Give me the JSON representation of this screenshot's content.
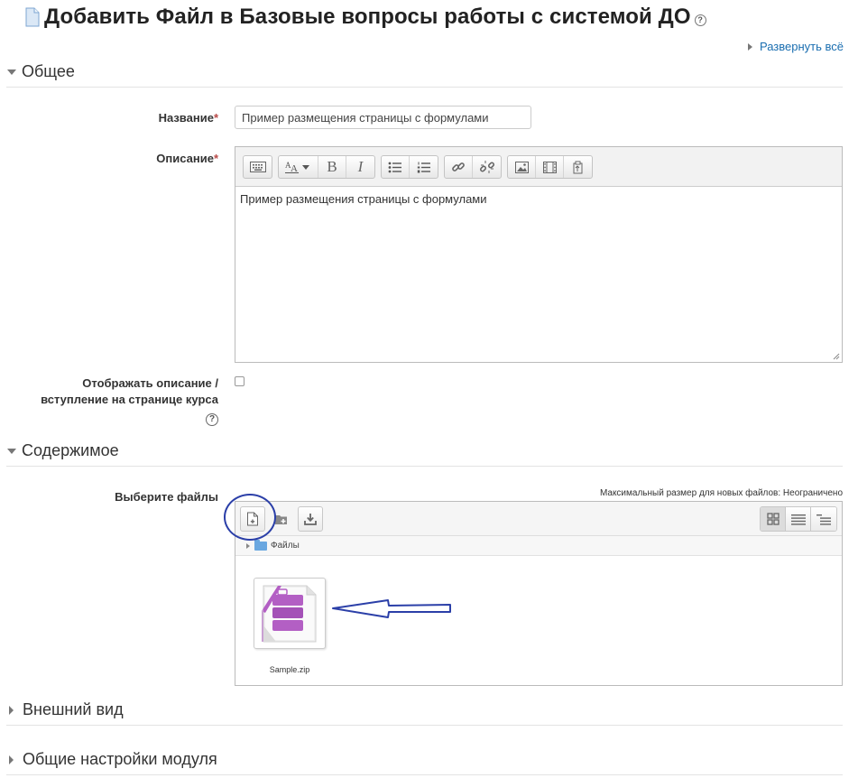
{
  "page": {
    "title": "Добавить Файл в Базовые вопросы работы с системой ДО",
    "title_help": "?",
    "expand_all": "Развернуть всё"
  },
  "sections": {
    "general": "Общее",
    "content": "Содержимое",
    "appearance": "Внешний вид",
    "module_settings": "Общие настройки модуля"
  },
  "form": {
    "name_label": "Название",
    "name_value": "Пример размещения страницы с формулами",
    "required_mark": "*",
    "description_label": "Описание",
    "description_text": "Пример размещения страницы с формулами",
    "show_description_label_1": "Отображать описание /",
    "show_description_label_2": "вступление на странице курса",
    "show_description_checked": false,
    "help": "?",
    "choose_files_label": "Выберите файлы",
    "max_size": "Максимальный размер для новых файлов: Неограничено"
  },
  "filemanager": {
    "path_folder": "Файлы",
    "file_name": "Sample.zip"
  },
  "colors": {
    "link": "#1a6eb0",
    "required": "#b94a48",
    "annotation": "#2b3fa8",
    "archive_purple": "#b35fc4"
  }
}
